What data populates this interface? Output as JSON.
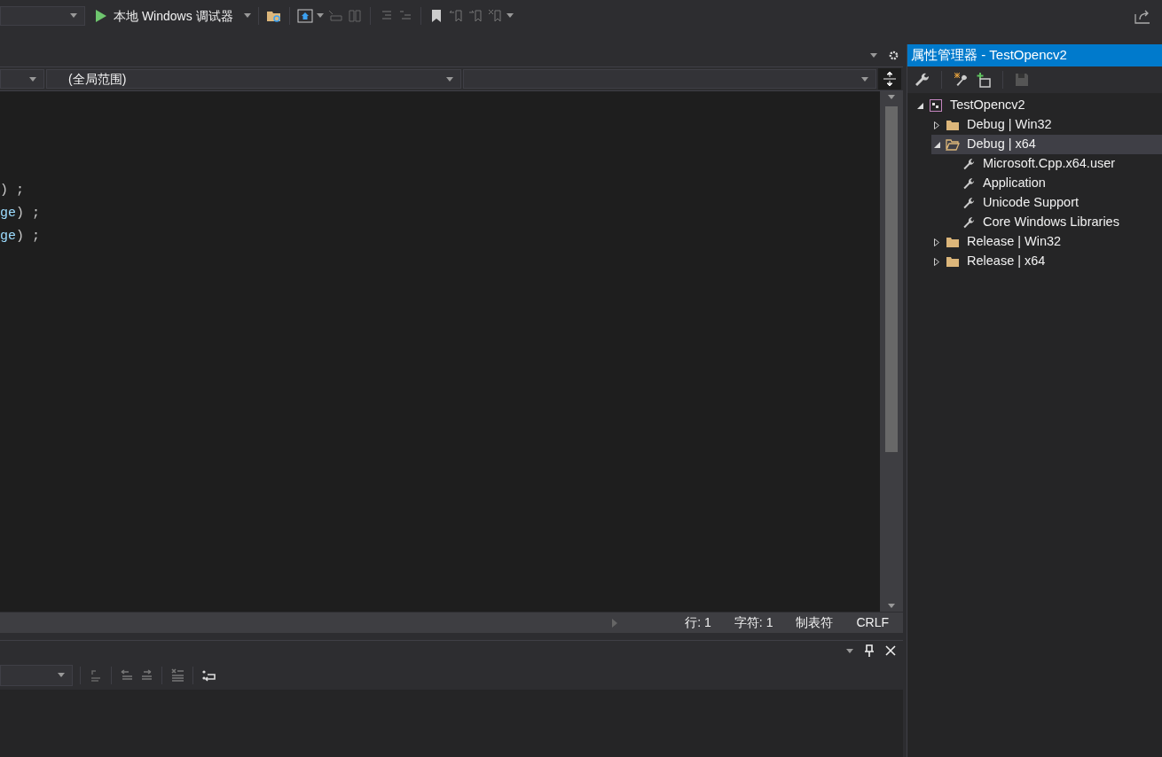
{
  "toolbar": {
    "debugger": "本地 Windows 调试器"
  },
  "editor": {
    "nav_bar": {
      "scope": "(全局范围)"
    },
    "code_lines": [
      [
        {
          "text": ")",
          "kind": "punct"
        },
        {
          "text": ";",
          "kind": "punct"
        }
      ],
      [
        {
          "text": "ge",
          "kind": "ident"
        },
        {
          "text": ")",
          "kind": "punct"
        },
        {
          "text": ";",
          "kind": "punct"
        }
      ],
      [
        {
          "text": "ge",
          "kind": "ident"
        },
        {
          "text": ")",
          "kind": "punct"
        },
        {
          "text": ";",
          "kind": "punct"
        }
      ]
    ],
    "status_bar": {
      "line": "行: 1",
      "char": "字符: 1",
      "indent": "制表符",
      "eol": "CRLF"
    }
  },
  "property_manager": {
    "title": "属性管理器 - TestOpencv2",
    "tree": [
      {
        "label": "TestOpencv2",
        "kind": "project",
        "expanded": true,
        "selected": false,
        "children": [
          {
            "label": "Debug | Win32",
            "kind": "config",
            "expanded": false,
            "selected": false
          },
          {
            "label": "Debug | x64",
            "kind": "config",
            "expanded": true,
            "selected": true,
            "children": [
              {
                "label": "Microsoft.Cpp.x64.user",
                "kind": "sheet",
                "selected": false
              },
              {
                "label": "Application",
                "kind": "sheet",
                "selected": false
              },
              {
                "label": "Unicode Support",
                "kind": "sheet",
                "selected": false
              },
              {
                "label": "Core Windows Libraries",
                "kind": "sheet",
                "selected": false
              }
            ]
          },
          {
            "label": "Release | Win32",
            "kind": "config",
            "expanded": false,
            "selected": false
          },
          {
            "label": "Release | x64",
            "kind": "config",
            "expanded": false,
            "selected": false
          }
        ]
      }
    ]
  }
}
